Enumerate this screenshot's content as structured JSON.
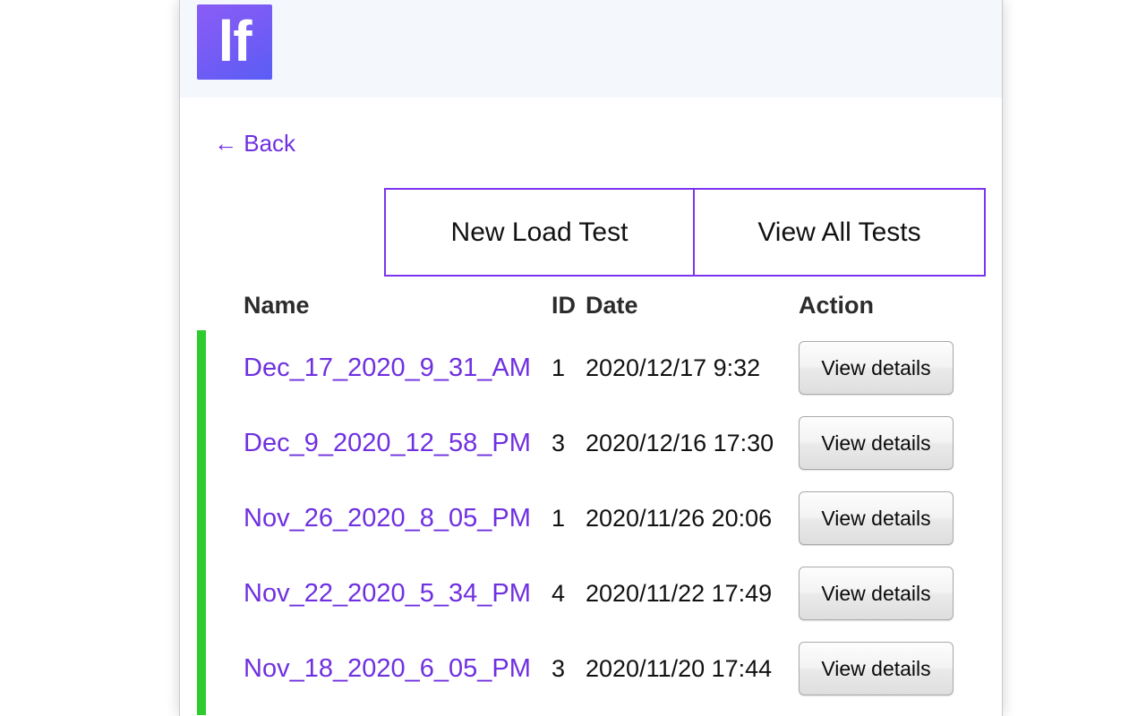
{
  "header": {
    "logo_text": "lf",
    "logo_icon": "brand-logo-icon",
    "logo_gradient_from": "#8a5cf6",
    "logo_gradient_to": "#5a5df5",
    "background": "#f4f8fc"
  },
  "nav": {
    "back_label": "← Back",
    "link_color": "#6f30e0"
  },
  "actions": {
    "new_load_test": "New Load Test",
    "view_all_tests": "View All Tests",
    "border_color": "#7b35f0"
  },
  "table": {
    "columns": [
      "Name",
      "ID",
      "Date",
      "Action"
    ],
    "status_color": "#2ecb2e",
    "action_button_label": "View details",
    "rows": [
      {
        "name": "Dec_17_2020_9_31_AM",
        "id": "1",
        "date": "2020/12/17 9:32",
        "action": "View details",
        "status": "ok"
      },
      {
        "name": "Dec_9_2020_12_58_PM",
        "id": "3",
        "date": "2020/12/16 17:30",
        "action": "View details",
        "status": "ok"
      },
      {
        "name": "Nov_26_2020_8_05_PM",
        "id": "1",
        "date": "2020/11/26 20:06",
        "action": "View details",
        "status": "ok"
      },
      {
        "name": "Nov_22_2020_5_34_PM",
        "id": "4",
        "date": "2020/11/22 17:49",
        "action": "View details",
        "status": "ok"
      },
      {
        "name": "Nov_18_2020_6_05_PM",
        "id": "3",
        "date": "2020/11/20 17:44",
        "action": "View details",
        "status": "ok"
      }
    ]
  }
}
